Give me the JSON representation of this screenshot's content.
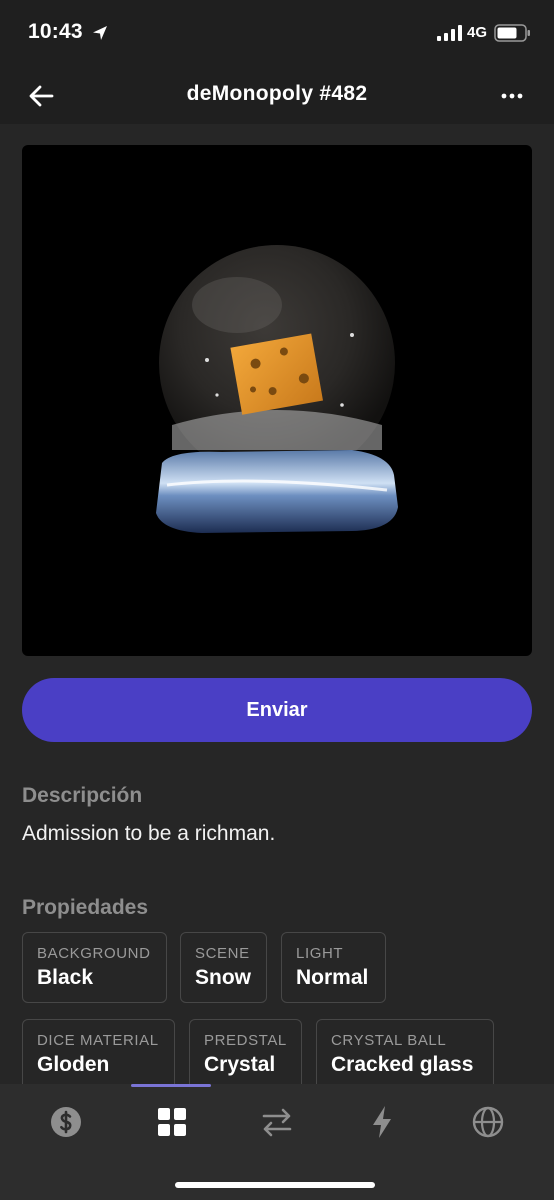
{
  "status_bar": {
    "time": "10:43",
    "network": "4G"
  },
  "nav": {
    "title": "deMonopoly #482"
  },
  "send_button": {
    "label": "Enviar"
  },
  "description": {
    "heading": "Descripción",
    "text": "Admission to be a richman."
  },
  "properties": {
    "heading": "Propiedades",
    "items": [
      {
        "name": "BACKGROUND",
        "value": "Black"
      },
      {
        "name": "SCENE",
        "value": "Snow"
      },
      {
        "name": "LIGHT",
        "value": "Normal"
      },
      {
        "name": "DICE MATERIAL",
        "value": "Gloden"
      },
      {
        "name": "PREDSTAL",
        "value": "Crystal"
      },
      {
        "name": "CRYSTAL BALL",
        "value": "Cracked glass"
      }
    ]
  },
  "tab_bar": {
    "active_index": 1,
    "tabs": [
      {
        "icon": "dollar-icon"
      },
      {
        "icon": "grid-icon"
      },
      {
        "icon": "swap-icon"
      },
      {
        "icon": "bolt-icon"
      },
      {
        "icon": "globe-icon"
      }
    ]
  },
  "colors": {
    "accent": "#4a3fc5",
    "background": "#262626",
    "tab_bar": "#2d2d2d"
  }
}
